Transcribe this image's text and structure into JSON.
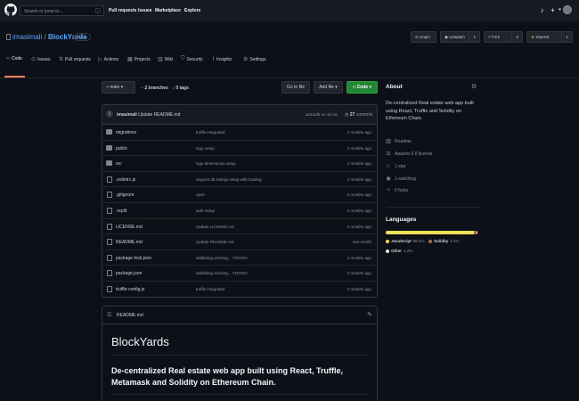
{
  "colors": {
    "bg": "#0d1117",
    "header_bg": "#161b22",
    "border": "#30363d",
    "link": "#58a6ff",
    "green": "#238636",
    "tab_active": "#f78166",
    "javascript": "#f1e05a",
    "solidity": "#aa6746",
    "other": "#ededed"
  },
  "topbar": {
    "search_placeholder": "Search or jump to...",
    "search_key": "/",
    "nav": [
      "Pull requests",
      "Issues",
      "Marketplace",
      "Explore"
    ]
  },
  "repo": {
    "owner": "imasimali",
    "separator": " / ",
    "name": "BlockYards",
    "visibility": "Public",
    "unpin": "Unpin",
    "unwatch": "Unwatch",
    "watch_count": "1",
    "fork": "Fork",
    "fork_count": "0",
    "starred": "Starred",
    "star_count": "1"
  },
  "tabs": [
    "Code",
    "Issues",
    "Pull requests",
    "Actions",
    "Projects",
    "Wiki",
    "Security",
    "Insights",
    "Settings"
  ],
  "toolbar": {
    "branch": "main",
    "branches": "2 branches",
    "tags": "0 tags",
    "goto_file": "Go to file",
    "add_file": "Add file",
    "code": "Code"
  },
  "commit": {
    "author": "imasimali",
    "message": "Update README.md",
    "hash": "a24a1f5",
    "date": "on Jul 18",
    "count": "27",
    "count_label": "commits"
  },
  "files": [
    {
      "name": "migrations",
      "type": "dir",
      "message": "truffle integrated",
      "age": "2 months ago"
    },
    {
      "name": "public",
      "type": "dir",
      "message": "logo setup",
      "age": "2 months ago"
    },
    {
      "name": "src",
      "type": "dir",
      "message": "logo dimensions setup",
      "age": "2 months ago"
    },
    {
      "name": ".eslintrc.js",
      "type": "file",
      "message": "request db listings setup with loading",
      "age": "2 months ago"
    },
    {
      "name": ".gitignore",
      "type": "file",
      "message": "upstr",
      "age": "3 months ago"
    },
    {
      "name": ".replit",
      "type": "file",
      "message": "auth setup",
      "age": "2 months ago"
    },
    {
      "name": "LICENSE.md",
      "type": "file",
      "message": "Update LICENSE.md",
      "age": "2 months ago"
    },
    {
      "name": "README.md",
      "type": "file",
      "message": "Update README.md",
      "age": "last month"
    },
    {
      "name": "package-lock.json",
      "type": "file",
      "message": "addlisting working... YOOOO",
      "age": "2 months ago"
    },
    {
      "name": "package.json",
      "type": "file",
      "message": "addlisting working... YOOOO",
      "age": "2 months ago"
    },
    {
      "name": "truffle-config.js",
      "type": "file",
      "message": "truffle integrated",
      "age": "2 months ago"
    }
  ],
  "readme": {
    "filename": "README.md",
    "title": "BlockYards",
    "subtitle": "De-centralized Real estate web app built using React, Truffle, Metamask and Solidity on Ethereum Chain."
  },
  "about": {
    "heading": "About",
    "description": "De-centralized Real estate web app built using React, Truffle and Solidity on Ethereum Chain.",
    "readme": "Readme",
    "license": "Apache-2.0 license",
    "stars": "1 star",
    "watching": "1 watching",
    "forks": "0 forks"
  },
  "languages": {
    "heading": "Languages",
    "items": [
      {
        "name": "JavaScript",
        "percent": "96.4%",
        "value": 96.4,
        "color": "#f1e05a"
      },
      {
        "name": "Solidity",
        "percent": "2.4%",
        "value": 2.4,
        "color": "#aa6746"
      },
      {
        "name": "Other",
        "percent": "1.2%",
        "value": 1.2,
        "color": "#ededed"
      }
    ]
  }
}
